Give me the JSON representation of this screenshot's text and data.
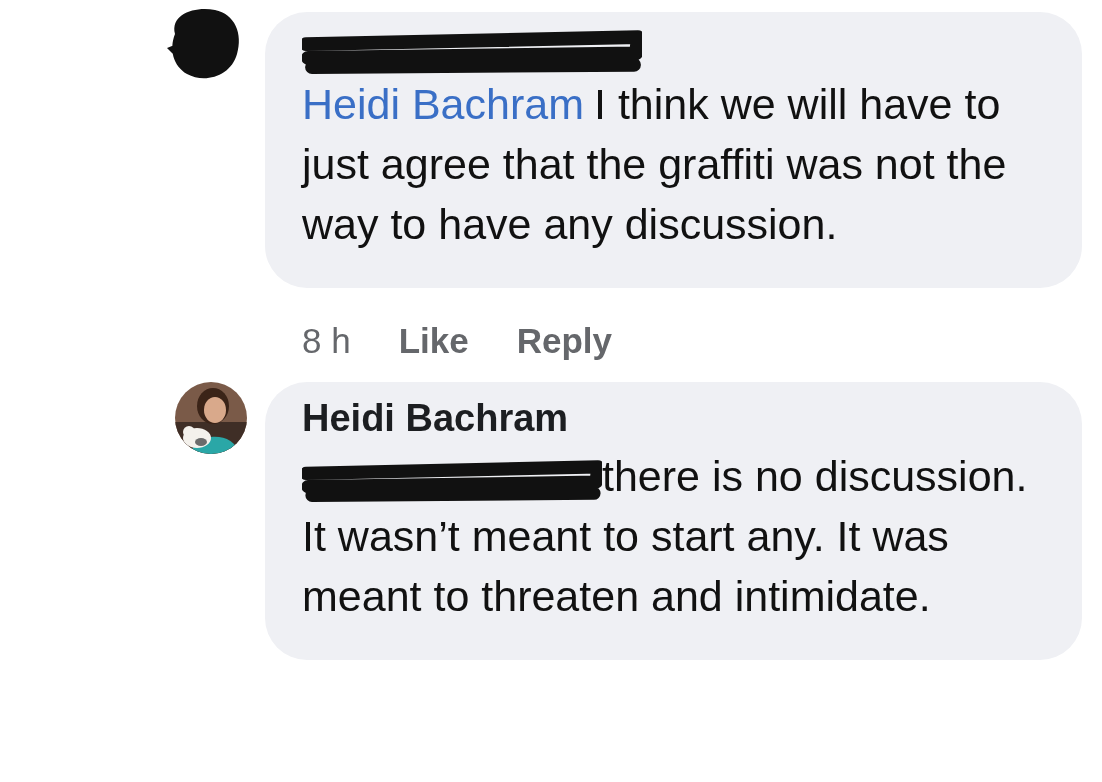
{
  "comments": [
    {
      "avatar": {
        "redacted": true
      },
      "author": {
        "redacted": true
      },
      "mention": {
        "text": "Heidi Bachram",
        "redacted": false
      },
      "text": "I think we will have to just agree that the graffiti was not the way to have any discussion.",
      "meta": {
        "time": "8 h",
        "actions": [
          "Like",
          "Reply"
        ]
      }
    },
    {
      "author": {
        "redacted": false,
        "name": "Heidi Bachram"
      },
      "mention": {
        "redacted": true
      },
      "text": "there is no discussion. It wasn’t meant to start any. It was meant to threaten and intimidate."
    }
  ]
}
